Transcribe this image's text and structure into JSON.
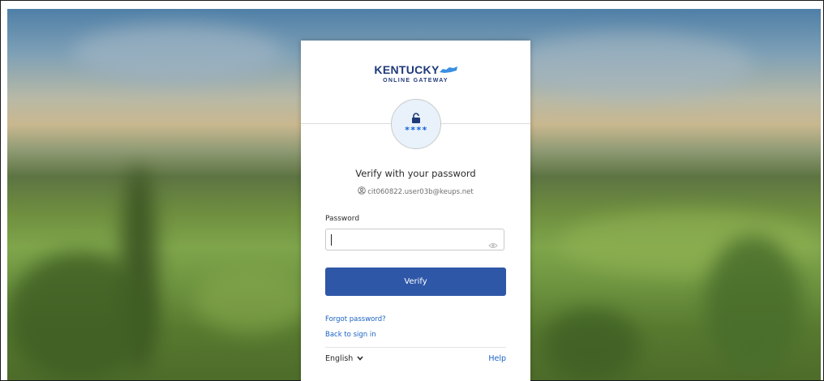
{
  "logo": {
    "line1": "KENTUCKY",
    "line2": "ONLINE GATEWAY"
  },
  "factor": {
    "icon": "lock-icon",
    "masked": "****"
  },
  "heading": "Verify with your password",
  "user": {
    "icon": "user-circle-icon",
    "identifier": "cit060822.user03b@keups.net"
  },
  "password_field": {
    "label": "Password",
    "value": "",
    "placeholder": "",
    "toggle_icon": "eye-icon"
  },
  "verify_button": {
    "label": "Verify"
  },
  "links": {
    "forgot_password": "Forgot password?",
    "back_to_sign_in": "Back to sign in"
  },
  "footer": {
    "language": "English",
    "language_icon": "chevron-down-icon",
    "help": "Help"
  },
  "colors": {
    "brand": "#1f3a7a",
    "button": "#2e57a8",
    "link": "#1a62c4",
    "badge_bg": "#e9f2fb",
    "accent": "#1662dd"
  }
}
